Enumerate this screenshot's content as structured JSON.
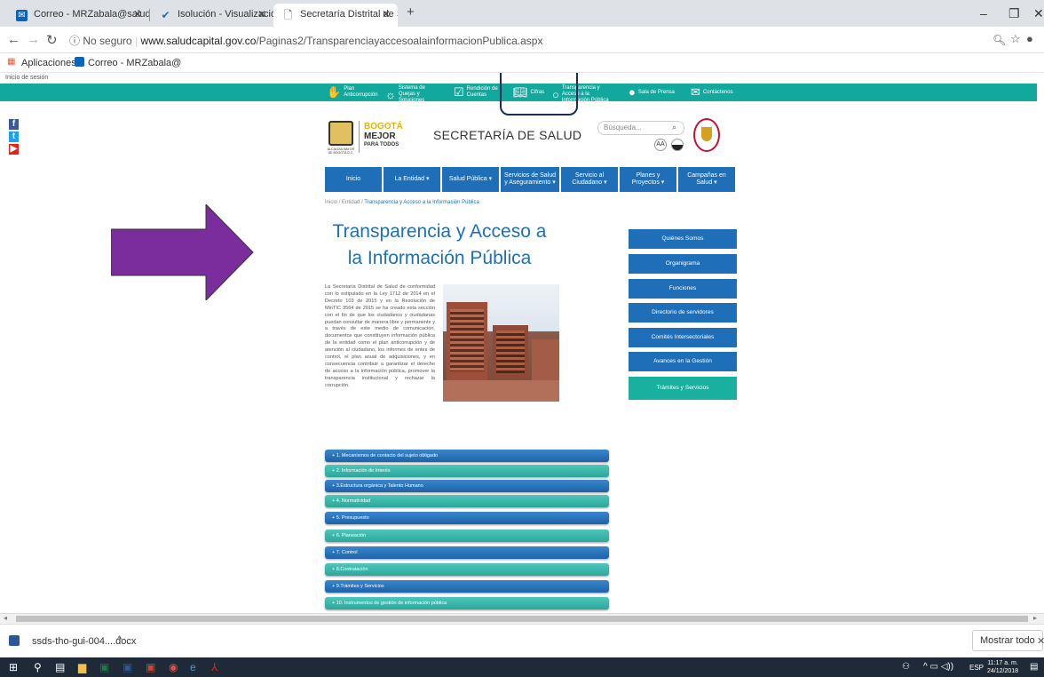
{
  "browser": {
    "tabs": [
      {
        "title": "Correo - MRZabala@saludcapita",
        "icon": "outlook-icon"
      },
      {
        "title": "Isolución - Visualización Docum",
        "icon": "check-icon"
      },
      {
        "title": "Secretaría Distrital de Salud de B",
        "icon": "page-icon"
      }
    ],
    "new_tab": "+",
    "window_controls": {
      "minimize": "–",
      "restore": "❐",
      "close": "✕"
    },
    "url_security": "No seguro",
    "url_host": "www.saludcapital.gov.co",
    "url_path": "/Paginas2/TransparenciayaccesoalainformacionPublica.aspx",
    "bookmarks": [
      {
        "label": "Aplicaciones",
        "icon": "apps-icon"
      },
      {
        "label": "Correo - MRZabala@",
        "icon": "outlook-icon"
      }
    ]
  },
  "site": {
    "session_link": "Inicio de sesión",
    "top_links": [
      {
        "label": "Plan Anticorrupción",
        "icon": "hand-icon"
      },
      {
        "label": "Sistema de Quejas y Soluciones",
        "icon": "bulb-icon"
      },
      {
        "label": "Rendición de Cuentas",
        "icon": "checkbox-icon"
      },
      {
        "label": "Cifras",
        "icon": "book-icon"
      },
      {
        "label": "Transparencia y Acceso a la Información Pública",
        "icon": "search-icon"
      },
      {
        "label": "Sala de Prensa",
        "icon": "speech-icon"
      },
      {
        "label": "Contáctenos",
        "icon": "mail-icon"
      }
    ],
    "logo_line1": "BOGOTÁ",
    "logo_line2": "MEJOR",
    "logo_line3": "PARA TODOS",
    "logo_sub": "ALCALDÍA MAYOR DE BOGOTÁ D.C.",
    "header_title": "SECRETARÍA DE SALUD",
    "search_placeholder": "Búsqueda...",
    "font_size_label": "AA",
    "main_nav": [
      "Inicio",
      "La Entidad ▾",
      "Salud Pública ▾",
      "Servicios de Salud y Aseguramiento ▾",
      "Servicio al Ciudadano ▾",
      "Planes y Proyectos ▾",
      "Campañas en Salud ▾"
    ],
    "breadcrumb": {
      "home": "Inicio",
      "sep": "/",
      "entity": "Entidad",
      "current": "Transparencia y Acceso a la Información Pública"
    },
    "page_title_line1": "Transparencia y Acceso a",
    "page_title_line2": "la Información Pública",
    "intro_text": "La Secretaría Distrital de Salud de conformidad con lo estipulado en la Ley 1712 de 2014 en el Decreto 103 de 2015 y en la Resolución de MinTIC 3564 de 2015 se ha creado esta sección con el fin de que los ciudadanos y ciudadanas puedan consultar de manera libre y permanente y a través de este medio de comunicación, documentos que constituyen información pública de la entidad como el plan anticorrupción y de atención al ciudadano, los informes de entes de control, el plan anual de adquisiciones, y en consecuencia contribuir a garantizar el derecho de acceso a la información pública, promover la transparencia institucional y rechazar la corrupción.",
    "side_buttons": [
      "Quiénes Somos",
      "Organigrama",
      "Funciones",
      "Directorio de servidores",
      "Comités Intersectoriales",
      "Avances en la Gestión",
      "Trámites y Servicios"
    ],
    "accordion": [
      "+ 1. Mecanismos de contacto del sujeto obligado",
      "+ 2. Información de Interés",
      "+ 3.Estructura orgánica y Talento Humano",
      "+ 4. Normatividad",
      "+ 5. Presupuesto",
      "+ 6. Planeación",
      "+ 7. Control",
      "+ 8.Contratación",
      "+ 9.Trámites y Servicios",
      "+ 10. Instrumentos de gestión de información pública"
    ]
  },
  "downloads": {
    "file": "ssds-tho-gui-004....docx",
    "show_all": "Mostrar todo",
    "close": "✕"
  },
  "taskbar": {
    "lang": "ESP",
    "time": "11:17 a. m.",
    "date": "24/12/2018"
  },
  "colors": {
    "teal": "#13a89e",
    "blue": "#1e6fb8",
    "arrow": "#7b2d9e"
  }
}
